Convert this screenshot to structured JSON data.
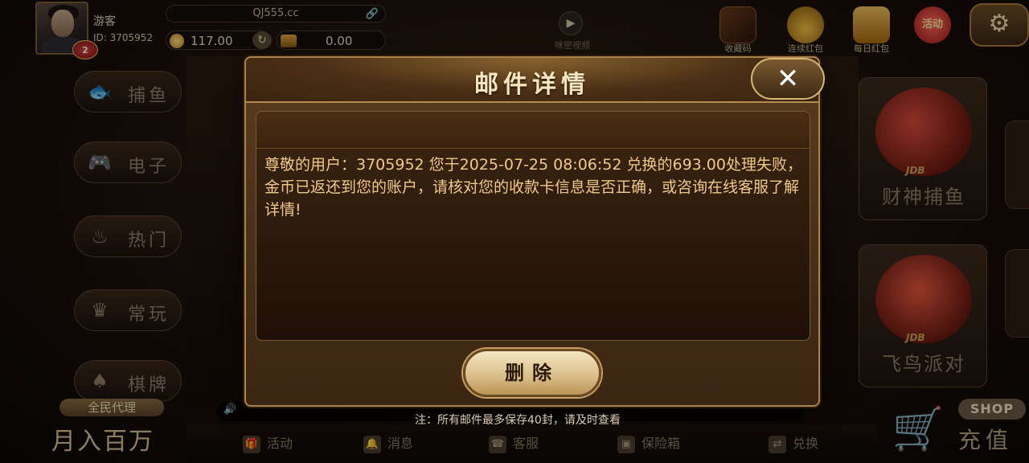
{
  "user": {
    "nickname": "游客",
    "id_label": "ID: 3705952",
    "vip_level": "2",
    "coins": "117.00",
    "bank": "0.00"
  },
  "site": {
    "address": "QJ555.cc"
  },
  "top_icons": {
    "video": "咪密视频",
    "collect": "收藏码",
    "red_packet": "连续红包",
    "daily_packet": "每日红包",
    "event": "活动"
  },
  "categories": [
    {
      "label": "捕鱼",
      "icon": "fish-icon"
    },
    {
      "label": "电子",
      "icon": "gamepad-icon"
    },
    {
      "label": "热门",
      "icon": "flame-icon"
    },
    {
      "label": "常玩",
      "icon": "crown-icon"
    },
    {
      "label": "棋牌",
      "icon": "cards-icon"
    }
  ],
  "promo": {
    "tag": "全民代理",
    "headline": "月入百万"
  },
  "game_tiles": [
    {
      "provider": "JDB",
      "name": "财神捕鱼"
    },
    {
      "provider": "JDB",
      "name": "飞鸟派对"
    }
  ],
  "bottom_nav": [
    {
      "label": "活动",
      "icon": "gift-icon"
    },
    {
      "label": "消息",
      "icon": "bell-icon"
    },
    {
      "label": "客服",
      "icon": "headset-icon"
    },
    {
      "label": "保险箱",
      "icon": "safe-icon"
    },
    {
      "label": "兑换",
      "icon": "exchange-icon"
    }
  ],
  "shop": {
    "badge": "SHOP",
    "label": "充值"
  },
  "modal": {
    "title": "邮件详情",
    "close_symbol": "✕",
    "message": "尊敬的用户：3705952 您于2025-07-25 08:06:52 兑换的693.00处理失败，金币已返还到您的账户，请核对您的收款卡信息是否正确，或咨询在线客服了解详情!",
    "delete_label": "删除",
    "note": "注：所有邮件最多保存40封，请及时查看"
  },
  "colors": {
    "accent_gold": "#a8834a",
    "message_text": "#f0c88a",
    "button_cream": "#f4e6c4"
  }
}
